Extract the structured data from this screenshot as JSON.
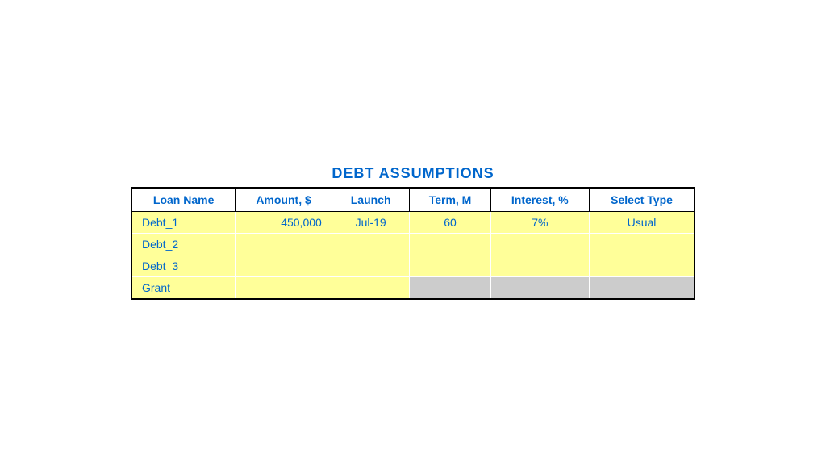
{
  "title": "DEBT ASSUMPTIONS",
  "columns": [
    {
      "id": "loan-name",
      "label": "Loan Name"
    },
    {
      "id": "amount",
      "label": "Amount, $"
    },
    {
      "id": "launch",
      "label": "Launch"
    },
    {
      "id": "term",
      "label": "Term, M"
    },
    {
      "id": "interest",
      "label": "Interest, %"
    },
    {
      "id": "select-type",
      "label": "Select Type"
    }
  ],
  "rows": [
    {
      "id": "debt-1",
      "cells": [
        {
          "value": "Debt_1",
          "align": "left",
          "bg": "yellow"
        },
        {
          "value": "450,000",
          "align": "right",
          "bg": "yellow"
        },
        {
          "value": "Jul-19",
          "align": "center",
          "bg": "yellow"
        },
        {
          "value": "60",
          "align": "center",
          "bg": "yellow"
        },
        {
          "value": "7%",
          "align": "center",
          "bg": "yellow"
        },
        {
          "value": "Usual",
          "align": "center",
          "bg": "yellow"
        }
      ]
    },
    {
      "id": "debt-2",
      "cells": [
        {
          "value": "Debt_2",
          "align": "left",
          "bg": "yellow"
        },
        {
          "value": "",
          "align": "right",
          "bg": "yellow"
        },
        {
          "value": "",
          "align": "center",
          "bg": "yellow"
        },
        {
          "value": "",
          "align": "center",
          "bg": "yellow"
        },
        {
          "value": "",
          "align": "center",
          "bg": "yellow"
        },
        {
          "value": "",
          "align": "center",
          "bg": "yellow"
        }
      ]
    },
    {
      "id": "debt-3",
      "cells": [
        {
          "value": "Debt_3",
          "align": "left",
          "bg": "yellow"
        },
        {
          "value": "",
          "align": "right",
          "bg": "yellow"
        },
        {
          "value": "",
          "align": "center",
          "bg": "yellow"
        },
        {
          "value": "",
          "align": "center",
          "bg": "yellow"
        },
        {
          "value": "",
          "align": "center",
          "bg": "yellow"
        },
        {
          "value": "",
          "align": "center",
          "bg": "yellow"
        }
      ]
    },
    {
      "id": "grant",
      "cells": [
        {
          "value": "Grant",
          "align": "left",
          "bg": "yellow"
        },
        {
          "value": "",
          "align": "right",
          "bg": "yellow"
        },
        {
          "value": "",
          "align": "center",
          "bg": "yellow"
        },
        {
          "value": "",
          "align": "center",
          "bg": "gray"
        },
        {
          "value": "",
          "align": "center",
          "bg": "gray"
        },
        {
          "value": "",
          "align": "center",
          "bg": "gray"
        }
      ]
    }
  ]
}
